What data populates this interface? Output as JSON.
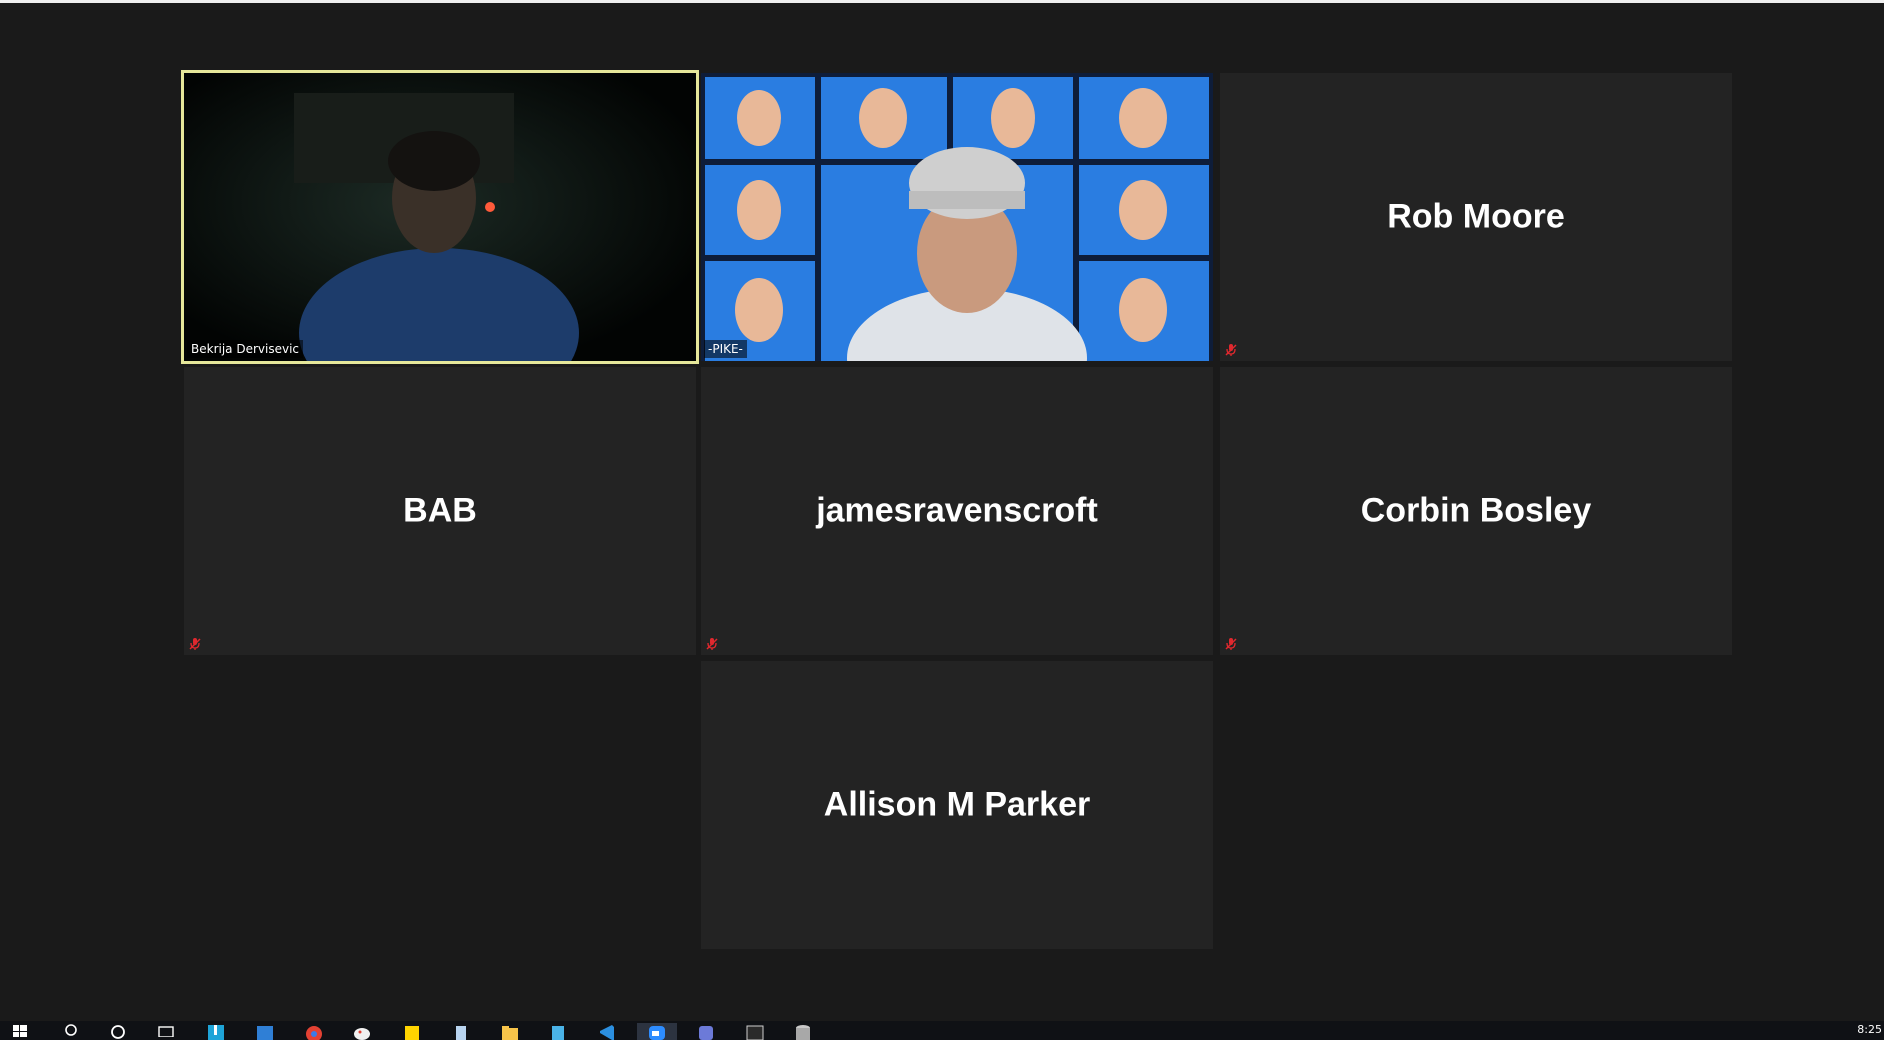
{
  "meeting": {
    "participants": [
      {
        "name": "Bekrija Dervisevic",
        "video": true,
        "speaking": true,
        "muted": false
      },
      {
        "name": "-PIKE-",
        "video": true,
        "speaking": false,
        "muted": false
      },
      {
        "name": "Rob Moore",
        "video": false,
        "muted": true
      },
      {
        "name": "BAB",
        "video": false,
        "muted": true
      },
      {
        "name": "jamesravenscroft",
        "video": false,
        "muted": true
      },
      {
        "name": "Corbin Bosley",
        "video": false,
        "muted": true
      },
      {
        "name": "Allison M Parker",
        "video": false,
        "muted": false
      }
    ],
    "colors": {
      "background": "#1a1a1a",
      "tile": "#232323",
      "active_speaker_border": "#e6e79a",
      "muted_icon": "#e0282e"
    }
  },
  "taskbar": {
    "items": [
      "windows-start",
      "search",
      "cortana",
      "task-view",
      "app-1",
      "mail",
      "chrome",
      "paint",
      "sticky-notes",
      "app-2",
      "file-explorer",
      "app-3",
      "vscode",
      "zoom",
      "app-4",
      "terminal",
      "app-5"
    ],
    "active": "zoom",
    "clock": "8:25"
  }
}
